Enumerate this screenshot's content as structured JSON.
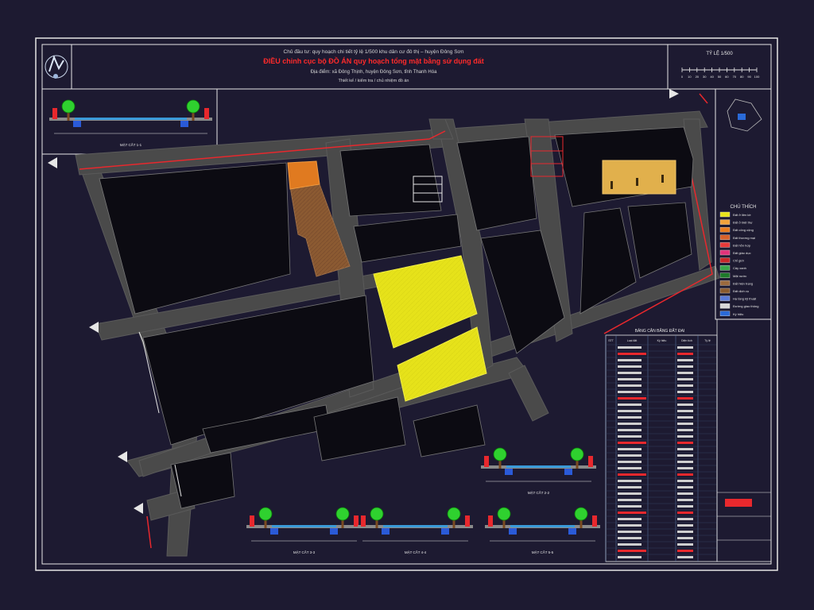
{
  "sheet": {
    "header_line1": "Chủ đầu tư: quy hoạch chi tiết tỷ lệ 1/500 khu dân cư đô thị – huyện Đông Sơn",
    "header_title": "ĐIỀU chỉnh cục bộ ĐỒ ÁN quy hoạch tổng mặt bằng sử dụng đất",
    "header_line3": "Địa điểm: xã Đông Thịnh, huyện Đông Sơn, tỉnh Thanh Hóa",
    "header_line4": "Thiết kế / kiểm tra / chủ nhiệm đồ án",
    "scale_title": "TỶ LỆ 1/500",
    "scale_ticks": [
      "0",
      "10",
      "20",
      "30",
      "40",
      "50",
      "60",
      "70",
      "80",
      "90",
      "100"
    ]
  },
  "sections": {
    "labels": [
      "MẶT CẮT 1-1",
      "MẶT CẮT 2-2",
      "MẶT CẮT 3-3",
      "MẶT CẮT 4-4",
      "MẶT CẮT 5-5"
    ]
  },
  "legend": {
    "title": "CHÚ THÍCH",
    "items": [
      {
        "color": "#e9e31b",
        "label": "Đất ở liền kề"
      },
      {
        "color": "#f2a23a",
        "label": "Đất ở biệt thự"
      },
      {
        "color": "#e87c1e",
        "label": "Đất công cộng"
      },
      {
        "color": "#d8622a",
        "label": "Đất thương mại"
      },
      {
        "color": "#e83a3a",
        "label": "Đất hỗn hợp"
      },
      {
        "color": "#e0327a",
        "label": "Đất giáo dục"
      },
      {
        "color": "#c82828",
        "label": "Chỉ giới"
      },
      {
        "color": "#3aa84a",
        "label": "Cây xanh"
      },
      {
        "color": "#1e7a2a",
        "label": "Mặt nước"
      },
      {
        "color": "#9b6a3e",
        "label": "Đất hiện trạng"
      },
      {
        "color": "#8a5a2e",
        "label": "Đất dịch vụ"
      },
      {
        "color": "#5a7ad8",
        "label": "Hạ tầng kỹ thuật"
      },
      {
        "color": "#d8d8d8",
        "label": "Đường giao thông"
      },
      {
        "color": "#2a6ad8",
        "label": "Ký hiệu"
      }
    ]
  },
  "table": {
    "title": "BẢNG CÂN BẰNG ĐẤT ĐAI",
    "columns": [
      "STT",
      "Loại đất",
      "Ký hiệu",
      "Diện tích",
      "Tỷ lệ"
    ]
  },
  "colors": {
    "background": "#1d1a31",
    "frame": "#e6e6e6",
    "road": "#4a4a4a",
    "red_line": "#e8282d",
    "yellow": "#e6e21a",
    "brown": "#8b5a32",
    "orange": "#e07a20"
  }
}
